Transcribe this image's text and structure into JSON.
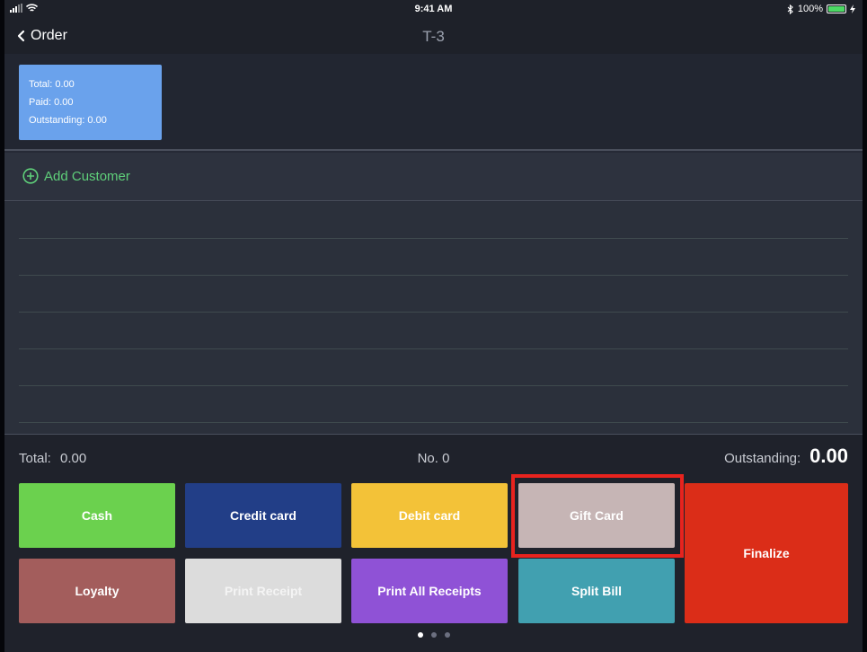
{
  "status_bar": {
    "time": "9:41 AM",
    "battery": "100%",
    "battery_level": 1.0
  },
  "nav": {
    "back_label": "Order",
    "title": "T-3"
  },
  "summary": {
    "total": "Total: 0.00",
    "paid": "Paid: 0.00",
    "outstanding": "Outstanding: 0.00"
  },
  "customer": {
    "add_label": "Add Customer"
  },
  "totals": {
    "total_label": "Total:",
    "total_value": "0.00",
    "number": "No. 0",
    "outstanding_label": "Outstanding:",
    "outstanding_value": "0.00"
  },
  "buttons": {
    "cash": "Cash",
    "credit_card": "Credit card",
    "debit_card": "Debit card",
    "gift_card": "Gift Card",
    "finalize": "Finalize",
    "loyalty": "Loyalty",
    "print_receipt": "Print Receipt",
    "print_all": "Print All Receipts",
    "split_bill": "Split Bill"
  },
  "colors": {
    "cash": "#6bd14e",
    "credit_card": "#223e87",
    "debit_card": "#f3c238",
    "gift_card": "#c6b5b5",
    "finalize": "#db2d18",
    "loyalty": "#a35d5c",
    "print_receipt": "#dcdcdc",
    "print_all": "#8f52d6",
    "split_bill": "#41a0b0",
    "highlight": "#e8231e",
    "summary_card": "#6aa2ec",
    "accent_green": "#5fd07a"
  },
  "pagination": {
    "count": 3,
    "active": 1
  }
}
